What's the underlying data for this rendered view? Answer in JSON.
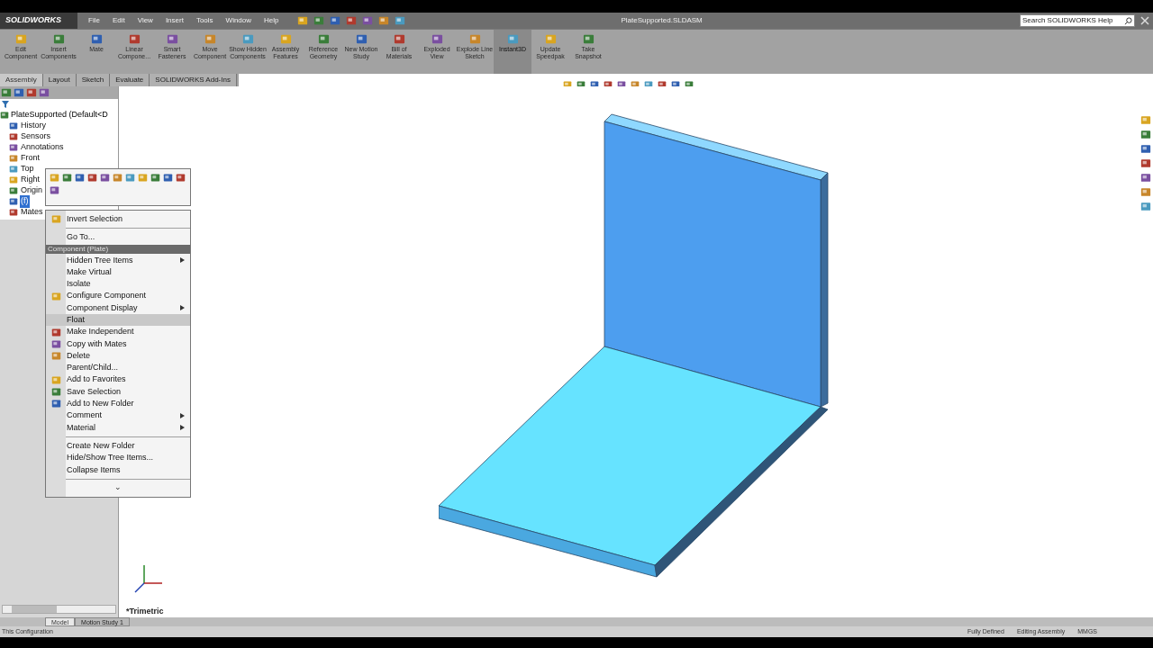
{
  "app": {
    "logo": "SOLIDWORKS",
    "menu_bar": [
      "File",
      "Edit",
      "View",
      "Insert",
      "Tools",
      "Window",
      "Help"
    ],
    "title": "PlateSupported.SLDASM",
    "search": {
      "placeholder": "Search SOLIDWORKS Help"
    }
  },
  "ribbon": [
    {
      "label": "Edit Component",
      "selected": false
    },
    {
      "label": "Insert Components",
      "selected": false
    },
    {
      "label": "Mate",
      "selected": false
    },
    {
      "label": "Linear Compone...",
      "selected": false
    },
    {
      "label": "Smart Fasteners",
      "selected": false
    },
    {
      "label": "Move Component",
      "selected": false
    },
    {
      "label": "Show Hidden Components",
      "selected": false
    },
    {
      "label": "Assembly Features",
      "selected": false
    },
    {
      "label": "Reference Geometry",
      "selected": false
    },
    {
      "label": "New Motion Study",
      "selected": false
    },
    {
      "label": "Bill of Materials",
      "selected": false
    },
    {
      "label": "Exploded View",
      "selected": false
    },
    {
      "label": "Explode Line Sketch",
      "selected": false
    },
    {
      "label": "Instant3D",
      "selected": true
    },
    {
      "label": "Update Speedpak",
      "selected": false
    },
    {
      "label": "Take Snapshot",
      "selected": false
    }
  ],
  "command_tabs": [
    {
      "label": "Assembly",
      "selected": true
    },
    {
      "label": "Layout",
      "selected": false
    },
    {
      "label": "Sketch",
      "selected": false
    },
    {
      "label": "Evaluate",
      "selected": false
    },
    {
      "label": "SOLIDWORKS Add-Ins",
      "selected": false
    }
  ],
  "tree": {
    "root": "PlateSupported  (Default<D",
    "items": [
      {
        "label": "History",
        "selected": false
      },
      {
        "label": "Sensors",
        "selected": false
      },
      {
        "label": "Annotations",
        "selected": false
      },
      {
        "label": "Front",
        "selected": false
      },
      {
        "label": "Top",
        "selected": false
      },
      {
        "label": "Right",
        "selected": false
      },
      {
        "label": "Origin",
        "selected": false
      },
      {
        "label": "(f)",
        "selected": true
      },
      {
        "label": "Mates",
        "selected": false
      }
    ]
  },
  "context_menu": [
    {
      "kind": "item",
      "label": "Invert Selection",
      "has_icon": true,
      "submenu": false,
      "selected": false
    },
    {
      "kind": "separator"
    },
    {
      "kind": "item",
      "label": "Go To...",
      "has_icon": false,
      "submenu": false,
      "selected": false
    },
    {
      "kind": "header",
      "label": "Component (Plate)"
    },
    {
      "kind": "item",
      "label": "Hidden Tree Items",
      "has_icon": false,
      "submenu": true,
      "selected": false
    },
    {
      "kind": "item",
      "label": "Make Virtual",
      "has_icon": false,
      "submenu": false,
      "selected": false
    },
    {
      "kind": "item",
      "label": "Isolate",
      "has_icon": false,
      "submenu": false,
      "selected": false
    },
    {
      "kind": "item",
      "label": "Configure Component",
      "has_icon": true,
      "submenu": false,
      "selected": false
    },
    {
      "kind": "item",
      "label": "Component Display",
      "has_icon": false,
      "submenu": true,
      "selected": false
    },
    {
      "kind": "item",
      "label": "Float",
      "has_icon": false,
      "submenu": false,
      "selected": true
    },
    {
      "kind": "item",
      "label": "Make Independent",
      "has_icon": true,
      "submenu": false,
      "selected": false
    },
    {
      "kind": "item",
      "label": "Copy with Mates",
      "has_icon": true,
      "submenu": false,
      "selected": false
    },
    {
      "kind": "item",
      "label": "Delete",
      "has_icon": true,
      "submenu": false,
      "selected": false
    },
    {
      "kind": "item",
      "label": "Parent/Child...",
      "has_icon": false,
      "submenu": false,
      "selected": false
    },
    {
      "kind": "item",
      "label": "Add to Favorites",
      "has_icon": true,
      "submenu": false,
      "selected": false
    },
    {
      "kind": "item",
      "label": "Save Selection",
      "has_icon": true,
      "submenu": false,
      "selected": false
    },
    {
      "kind": "item",
      "label": "Add to New Folder",
      "has_icon": true,
      "submenu": false,
      "selected": false
    },
    {
      "kind": "item",
      "label": "Comment",
      "has_icon": false,
      "submenu": true,
      "selected": false
    },
    {
      "kind": "item",
      "label": "Material",
      "has_icon": false,
      "submenu": true,
      "selected": false
    },
    {
      "kind": "separator"
    },
    {
      "kind": "item",
      "label": "Create New Folder",
      "has_icon": false,
      "submenu": false,
      "selected": false
    },
    {
      "kind": "item",
      "label": "Hide/Show Tree Items...",
      "has_icon": false,
      "submenu": false,
      "selected": false
    },
    {
      "kind": "item",
      "label": "Collapse Items",
      "has_icon": false,
      "submenu": false,
      "selected": false
    },
    {
      "kind": "separator"
    },
    {
      "kind": "more",
      "label": "⌄"
    }
  ],
  "viewport": {
    "view_label": "*Trimetric"
  },
  "bottom_tabs": [
    {
      "label": "Model",
      "selected": true
    },
    {
      "label": "Motion Study 1",
      "selected": false
    }
  ],
  "status_bar": {
    "left": "This Configuration",
    "items": [
      "Fully Defined",
      "Editing Assembly",
      "MMGS"
    ]
  }
}
